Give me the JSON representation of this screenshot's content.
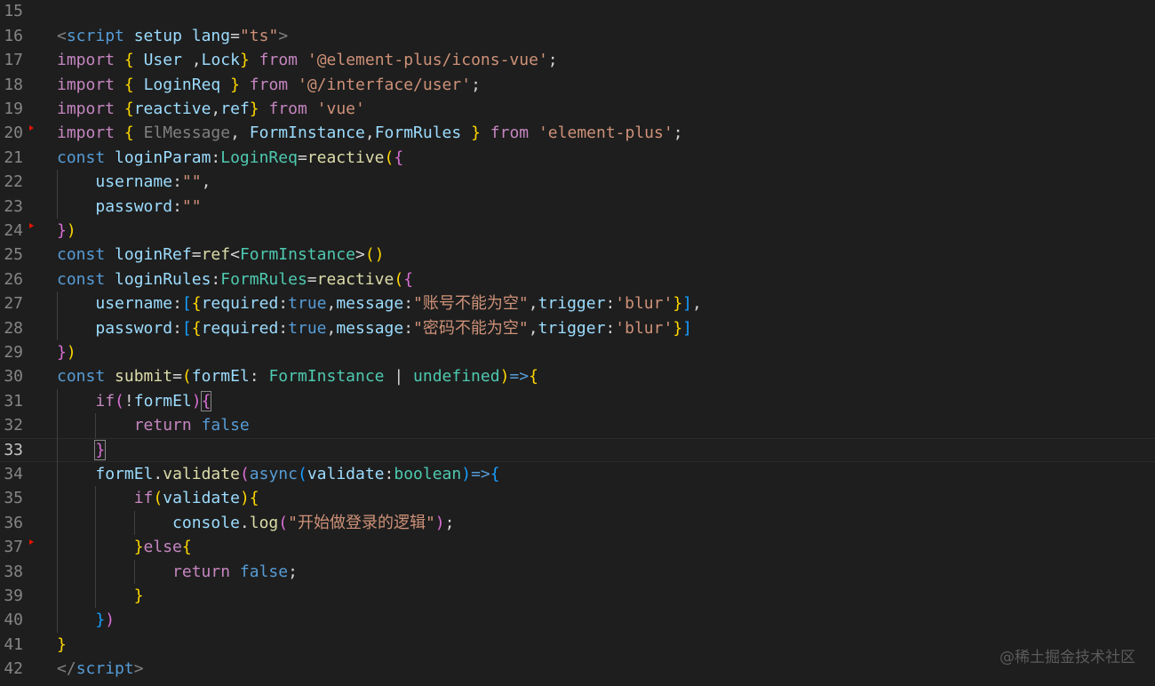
{
  "editor": {
    "theme_colors": {
      "background": "#1e1e1e",
      "line_number": "#858585",
      "keyword_blue": "#569cd6",
      "control_purple": "#c586c0",
      "variable": "#9cdcfe",
      "type": "#4ec9b0",
      "string": "#ce9178",
      "function": "#dcdcaa",
      "bracket_gold": "#ffd700",
      "bracket_pink": "#da70d6",
      "bracket_blue": "#179fff"
    },
    "marker_lines": [
      20,
      24,
      37
    ],
    "current_line": 33,
    "lines": [
      {
        "n": "15",
        "tokens": []
      },
      {
        "n": "16",
        "tokens": [
          {
            "t": "<",
            "c": "#808080"
          },
          {
            "t": "script",
            "c": "#569cd6"
          },
          {
            "t": " "
          },
          {
            "t": "setup",
            "c": "#9cdcfe"
          },
          {
            "t": " "
          },
          {
            "t": "lang",
            "c": "#9cdcfe"
          },
          {
            "t": "=",
            "c": "#d4d4d4"
          },
          {
            "t": "\"ts\"",
            "c": "#ce9178"
          },
          {
            "t": ">",
            "c": "#808080"
          }
        ]
      },
      {
        "n": "17",
        "tokens": [
          {
            "t": "import",
            "c": "#c586c0"
          },
          {
            "t": " "
          },
          {
            "t": "{",
            "c": "#ffd700"
          },
          {
            "t": " "
          },
          {
            "t": "User",
            "c": "#9cdcfe"
          },
          {
            "t": " ,",
            "c": "#d4d4d4"
          },
          {
            "t": "Lock",
            "c": "#9cdcfe"
          },
          {
            "t": "}",
            "c": "#ffd700"
          },
          {
            "t": " "
          },
          {
            "t": "from",
            "c": "#c586c0"
          },
          {
            "t": " "
          },
          {
            "t": "'@element-plus/icons-vue'",
            "c": "#ce9178"
          },
          {
            "t": ";",
            "c": "#d4d4d4"
          }
        ]
      },
      {
        "n": "18",
        "tokens": [
          {
            "t": "import",
            "c": "#c586c0"
          },
          {
            "t": " "
          },
          {
            "t": "{",
            "c": "#ffd700"
          },
          {
            "t": " "
          },
          {
            "t": "LoginReq",
            "c": "#9cdcfe"
          },
          {
            "t": " "
          },
          {
            "t": "}",
            "c": "#ffd700"
          },
          {
            "t": " "
          },
          {
            "t": "from",
            "c": "#c586c0"
          },
          {
            "t": " "
          },
          {
            "t": "'@/interface/user'",
            "c": "#ce9178"
          },
          {
            "t": ";",
            "c": "#d4d4d4"
          }
        ]
      },
      {
        "n": "19",
        "tokens": [
          {
            "t": "import",
            "c": "#c586c0"
          },
          {
            "t": " "
          },
          {
            "t": "{",
            "c": "#ffd700"
          },
          {
            "t": "reactive",
            "c": "#9cdcfe"
          },
          {
            "t": ",",
            "c": "#d4d4d4"
          },
          {
            "t": "ref",
            "c": "#9cdcfe"
          },
          {
            "t": "}",
            "c": "#ffd700"
          },
          {
            "t": " "
          },
          {
            "t": "from",
            "c": "#c586c0"
          },
          {
            "t": " "
          },
          {
            "t": "'vue'",
            "c": "#ce9178"
          }
        ]
      },
      {
        "n": "20",
        "tokens": [
          {
            "t": "import",
            "c": "#c586c0"
          },
          {
            "t": " "
          },
          {
            "t": "{",
            "c": "#ffd700"
          },
          {
            "t": " "
          },
          {
            "t": "ElMessage",
            "c": "#808080"
          },
          {
            "t": ", ",
            "c": "#d4d4d4"
          },
          {
            "t": "FormInstance",
            "c": "#9cdcfe"
          },
          {
            "t": ",",
            "c": "#d4d4d4"
          },
          {
            "t": "FormRules",
            "c": "#9cdcfe"
          },
          {
            "t": " "
          },
          {
            "t": "}",
            "c": "#ffd700"
          },
          {
            "t": " "
          },
          {
            "t": "from",
            "c": "#c586c0"
          },
          {
            "t": " "
          },
          {
            "t": "'element-plus'",
            "c": "#ce9178"
          },
          {
            "t": ";",
            "c": "#d4d4d4"
          }
        ]
      },
      {
        "n": "21",
        "tokens": [
          {
            "t": "const",
            "c": "#569cd6"
          },
          {
            "t": " "
          },
          {
            "t": "loginParam",
            "c": "#9cdcfe"
          },
          {
            "t": ":",
            "c": "#d4d4d4"
          },
          {
            "t": "LoginReq",
            "c": "#4ec9b0"
          },
          {
            "t": "=",
            "c": "#d4d4d4"
          },
          {
            "t": "reactive",
            "c": "#dcdcaa"
          },
          {
            "t": "(",
            "c": "#ffd700"
          },
          {
            "t": "{",
            "c": "#da70d6"
          }
        ]
      },
      {
        "n": "22",
        "tokens": [
          {
            "t": "    "
          },
          {
            "t": "username",
            "c": "#9cdcfe"
          },
          {
            "t": ":",
            "c": "#d4d4d4"
          },
          {
            "t": "\"\"",
            "c": "#ce9178"
          },
          {
            "t": ",",
            "c": "#d4d4d4"
          }
        ]
      },
      {
        "n": "23",
        "tokens": [
          {
            "t": "    "
          },
          {
            "t": "password",
            "c": "#9cdcfe"
          },
          {
            "t": ":",
            "c": "#d4d4d4"
          },
          {
            "t": "\"\"",
            "c": "#ce9178"
          }
        ]
      },
      {
        "n": "24",
        "tokens": [
          {
            "t": "}",
            "c": "#da70d6"
          },
          {
            "t": ")",
            "c": "#ffd700"
          }
        ]
      },
      {
        "n": "25",
        "tokens": [
          {
            "t": "const",
            "c": "#569cd6"
          },
          {
            "t": " "
          },
          {
            "t": "loginRef",
            "c": "#9cdcfe"
          },
          {
            "t": "=",
            "c": "#d4d4d4"
          },
          {
            "t": "ref",
            "c": "#dcdcaa"
          },
          {
            "t": "<",
            "c": "#d4d4d4"
          },
          {
            "t": "FormInstance",
            "c": "#4ec9b0"
          },
          {
            "t": ">",
            "c": "#d4d4d4"
          },
          {
            "t": "()",
            "c": "#ffd700"
          }
        ]
      },
      {
        "n": "26",
        "tokens": [
          {
            "t": "const",
            "c": "#569cd6"
          },
          {
            "t": " "
          },
          {
            "t": "loginRules",
            "c": "#9cdcfe"
          },
          {
            "t": ":",
            "c": "#d4d4d4"
          },
          {
            "t": "FormRules",
            "c": "#4ec9b0"
          },
          {
            "t": "=",
            "c": "#d4d4d4"
          },
          {
            "t": "reactive",
            "c": "#dcdcaa"
          },
          {
            "t": "(",
            "c": "#ffd700"
          },
          {
            "t": "{",
            "c": "#da70d6"
          }
        ]
      },
      {
        "n": "27",
        "tokens": [
          {
            "t": "    "
          },
          {
            "t": "username",
            "c": "#9cdcfe"
          },
          {
            "t": ":",
            "c": "#d4d4d4"
          },
          {
            "t": "[",
            "c": "#179fff"
          },
          {
            "t": "{",
            "c": "#ffd700"
          },
          {
            "t": "required",
            "c": "#9cdcfe"
          },
          {
            "t": ":",
            "c": "#d4d4d4"
          },
          {
            "t": "true",
            "c": "#569cd6"
          },
          {
            "t": ",",
            "c": "#d4d4d4"
          },
          {
            "t": "message",
            "c": "#9cdcfe"
          },
          {
            "t": ":",
            "c": "#d4d4d4"
          },
          {
            "t": "\"账号不能为空\"",
            "c": "#ce9178"
          },
          {
            "t": ",",
            "c": "#d4d4d4"
          },
          {
            "t": "trigger",
            "c": "#9cdcfe"
          },
          {
            "t": ":",
            "c": "#d4d4d4"
          },
          {
            "t": "'blur'",
            "c": "#ce9178"
          },
          {
            "t": "}",
            "c": "#ffd700"
          },
          {
            "t": "]",
            "c": "#179fff"
          },
          {
            "t": ",",
            "c": "#d4d4d4"
          }
        ]
      },
      {
        "n": "28",
        "tokens": [
          {
            "t": "    "
          },
          {
            "t": "password",
            "c": "#9cdcfe"
          },
          {
            "t": ":",
            "c": "#d4d4d4"
          },
          {
            "t": "[",
            "c": "#179fff"
          },
          {
            "t": "{",
            "c": "#ffd700"
          },
          {
            "t": "required",
            "c": "#9cdcfe"
          },
          {
            "t": ":",
            "c": "#d4d4d4"
          },
          {
            "t": "true",
            "c": "#569cd6"
          },
          {
            "t": ",",
            "c": "#d4d4d4"
          },
          {
            "t": "message",
            "c": "#9cdcfe"
          },
          {
            "t": ":",
            "c": "#d4d4d4"
          },
          {
            "t": "\"密码不能为空\"",
            "c": "#ce9178"
          },
          {
            "t": ",",
            "c": "#d4d4d4"
          },
          {
            "t": "trigger",
            "c": "#9cdcfe"
          },
          {
            "t": ":",
            "c": "#d4d4d4"
          },
          {
            "t": "'blur'",
            "c": "#ce9178"
          },
          {
            "t": "}",
            "c": "#ffd700"
          },
          {
            "t": "]",
            "c": "#179fff"
          }
        ]
      },
      {
        "n": "29",
        "tokens": [
          {
            "t": "}",
            "c": "#da70d6"
          },
          {
            "t": ")",
            "c": "#ffd700"
          }
        ]
      },
      {
        "n": "30",
        "tokens": [
          {
            "t": "const",
            "c": "#569cd6"
          },
          {
            "t": " "
          },
          {
            "t": "submit",
            "c": "#dcdcaa"
          },
          {
            "t": "=",
            "c": "#d4d4d4"
          },
          {
            "t": "(",
            "c": "#ffd700"
          },
          {
            "t": "formEl",
            "c": "#9cdcfe"
          },
          {
            "t": ": ",
            "c": "#d4d4d4"
          },
          {
            "t": "FormInstance",
            "c": "#4ec9b0"
          },
          {
            "t": " | ",
            "c": "#d4d4d4"
          },
          {
            "t": "undefined",
            "c": "#4ec9b0"
          },
          {
            "t": ")",
            "c": "#ffd700"
          },
          {
            "t": "=>",
            "c": "#569cd6"
          },
          {
            "t": "{",
            "c": "#ffd700"
          }
        ]
      },
      {
        "n": "31",
        "tokens": [
          {
            "t": "    "
          },
          {
            "t": "if",
            "c": "#c586c0"
          },
          {
            "t": "(",
            "c": "#da70d6"
          },
          {
            "t": "!",
            "c": "#d4d4d4"
          },
          {
            "t": "formEl",
            "c": "#9cdcfe"
          },
          {
            "t": ")",
            "c": "#da70d6"
          },
          {
            "t": "{",
            "c": "#da70d6",
            "box": true
          }
        ]
      },
      {
        "n": "32",
        "tokens": [
          {
            "t": "        "
          },
          {
            "t": "return",
            "c": "#c586c0"
          },
          {
            "t": " "
          },
          {
            "t": "false",
            "c": "#569cd6"
          }
        ]
      },
      {
        "n": "33",
        "tokens": [
          {
            "t": "    "
          },
          {
            "t": "}",
            "c": "#da70d6",
            "box": true
          }
        ]
      },
      {
        "n": "34",
        "tokens": [
          {
            "t": "    "
          },
          {
            "t": "formEl",
            "c": "#9cdcfe"
          },
          {
            "t": ".",
            "c": "#d4d4d4"
          },
          {
            "t": "validate",
            "c": "#dcdcaa"
          },
          {
            "t": "(",
            "c": "#da70d6"
          },
          {
            "t": "async",
            "c": "#569cd6"
          },
          {
            "t": "(",
            "c": "#179fff"
          },
          {
            "t": "validate",
            "c": "#9cdcfe"
          },
          {
            "t": ":",
            "c": "#d4d4d4"
          },
          {
            "t": "boolean",
            "c": "#4ec9b0"
          },
          {
            "t": ")",
            "c": "#179fff"
          },
          {
            "t": "=>",
            "c": "#569cd6"
          },
          {
            "t": "{",
            "c": "#179fff"
          }
        ]
      },
      {
        "n": "35",
        "tokens": [
          {
            "t": "        "
          },
          {
            "t": "if",
            "c": "#c586c0"
          },
          {
            "t": "(",
            "c": "#ffd700"
          },
          {
            "t": "validate",
            "c": "#9cdcfe"
          },
          {
            "t": ")",
            "c": "#ffd700"
          },
          {
            "t": "{",
            "c": "#ffd700"
          }
        ]
      },
      {
        "n": "36",
        "tokens": [
          {
            "t": "            "
          },
          {
            "t": "console",
            "c": "#9cdcfe"
          },
          {
            "t": ".",
            "c": "#d4d4d4"
          },
          {
            "t": "log",
            "c": "#dcdcaa"
          },
          {
            "t": "(",
            "c": "#da70d6"
          },
          {
            "t": "\"开始做登录的逻辑\"",
            "c": "#ce9178"
          },
          {
            "t": ")",
            "c": "#da70d6"
          },
          {
            "t": ";",
            "c": "#d4d4d4"
          }
        ]
      },
      {
        "n": "37",
        "tokens": [
          {
            "t": "        "
          },
          {
            "t": "}",
            "c": "#ffd700"
          },
          {
            "t": "else",
            "c": "#c586c0"
          },
          {
            "t": "{",
            "c": "#ffd700"
          }
        ]
      },
      {
        "n": "38",
        "tokens": [
          {
            "t": "            "
          },
          {
            "t": "return",
            "c": "#c586c0"
          },
          {
            "t": " "
          },
          {
            "t": "false",
            "c": "#569cd6"
          },
          {
            "t": ";",
            "c": "#d4d4d4"
          }
        ]
      },
      {
        "n": "39",
        "tokens": [
          {
            "t": "        "
          },
          {
            "t": "}",
            "c": "#ffd700"
          }
        ]
      },
      {
        "n": "40",
        "tokens": [
          {
            "t": "    "
          },
          {
            "t": "}",
            "c": "#179fff"
          },
          {
            "t": ")",
            "c": "#da70d6"
          }
        ]
      },
      {
        "n": "41",
        "tokens": [
          {
            "t": "}",
            "c": "#ffd700"
          }
        ]
      },
      {
        "n": "42",
        "tokens": [
          {
            "t": "</",
            "c": "#808080"
          },
          {
            "t": "script",
            "c": "#569cd6"
          },
          {
            "t": ">",
            "c": "#808080"
          }
        ]
      }
    ]
  },
  "watermark": "@稀土掘金技术社区"
}
